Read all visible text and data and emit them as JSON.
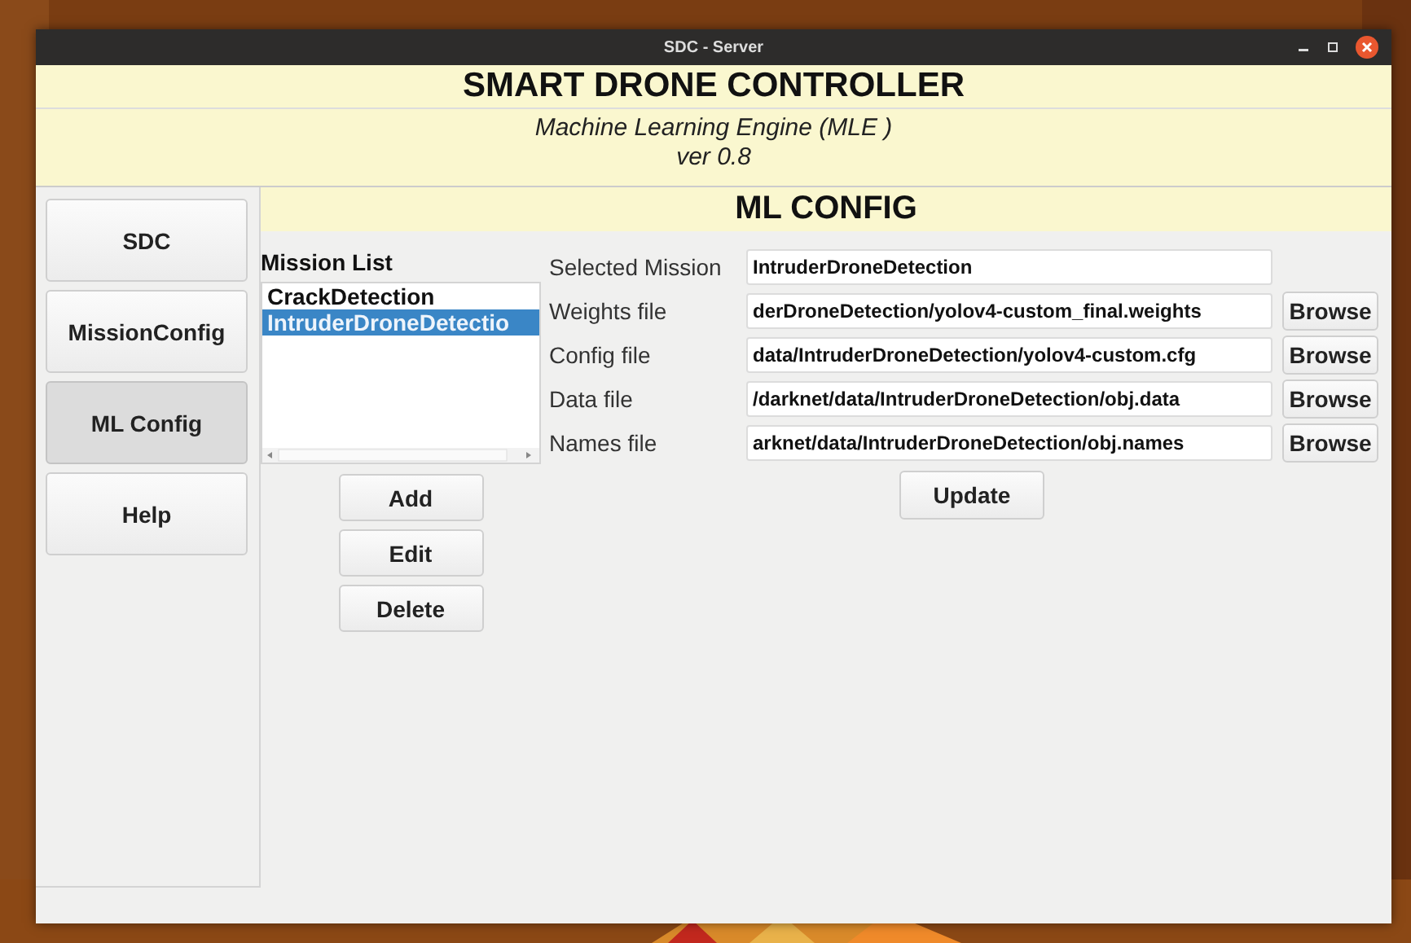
{
  "window": {
    "title": "SDC - Server"
  },
  "header": {
    "title": "SMART DRONE CONTROLLER",
    "subtitle": "Machine Learning Engine (MLE )",
    "version": "ver 0.8"
  },
  "sidebar": {
    "items": [
      {
        "label": "SDC",
        "selected": false
      },
      {
        "label": "MissionConfig",
        "selected": false
      },
      {
        "label": "ML Config",
        "selected": true
      },
      {
        "label": "Help",
        "selected": false
      }
    ]
  },
  "section_title": "ML CONFIG",
  "mission_list": {
    "label": "Mission List",
    "items": [
      {
        "label": "CrackDetection",
        "selected": false
      },
      {
        "label": "IntruderDroneDetectio",
        "selected": true
      }
    ],
    "buttons": [
      "Add",
      "Edit",
      "Delete"
    ]
  },
  "form": {
    "fields": [
      {
        "label": "Selected Mission",
        "value": "IntruderDroneDetection"
      },
      {
        "label": "Weights file",
        "value": "derDroneDetection/yolov4-custom_final.weights",
        "button": "Browse"
      },
      {
        "label": "Config file",
        "value": "data/IntruderDroneDetection/yolov4-custom.cfg",
        "button": "Browse"
      },
      {
        "label": "Data file",
        "value": "/darknet/data/IntruderDroneDetection/obj.data",
        "button": "Browse"
      },
      {
        "label": "Names file",
        "value": "arknet/data/IntruderDroneDetection/obj.names",
        "button": "Browse"
      }
    ],
    "update_button": "Update"
  }
}
